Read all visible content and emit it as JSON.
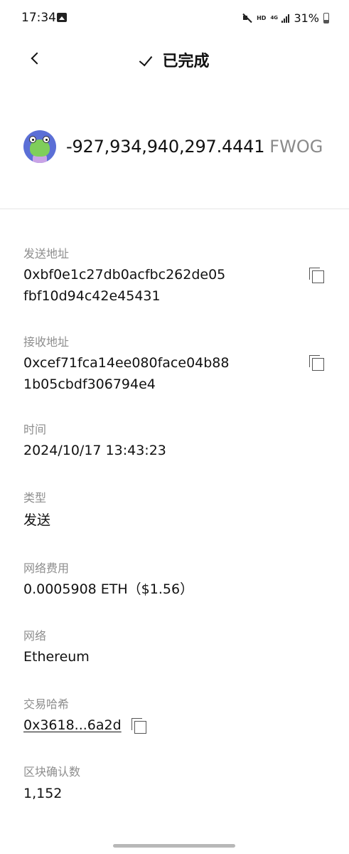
{
  "status_bar": {
    "time": "17:34",
    "hd_label": "HD",
    "network_label": "4G",
    "battery_percent": "31%"
  },
  "header": {
    "title": "已完成"
  },
  "amount": {
    "value": "-927,934,940,297.4441",
    "symbol": "FWOG"
  },
  "fields": {
    "from": {
      "label": "发送地址",
      "line1": "0xbf0e1c27db0acfbc262de05",
      "line2": "fbf10d94c42e45431"
    },
    "to": {
      "label": "接收地址",
      "line1": "0xcef71fca14ee080face04b88",
      "line2": "1b05cbdf306794e4"
    },
    "time": {
      "label": "时间",
      "value": "2024/10/17 13:43:23"
    },
    "type": {
      "label": "类型",
      "value": "发送"
    },
    "fee": {
      "label": "网络费用",
      "value": "0.0005908 ETH（$1.56）"
    },
    "network": {
      "label": "网络",
      "value": "Ethereum"
    },
    "tx_hash": {
      "label": "交易哈希",
      "value": "0x3618...6a2d"
    },
    "confirmations": {
      "label": "区块确认数",
      "value": "1,152"
    }
  },
  "icons": {
    "back": "chevron-left-icon",
    "status": "check-icon",
    "copy": "copy-icon",
    "token": "frog-avatar"
  }
}
